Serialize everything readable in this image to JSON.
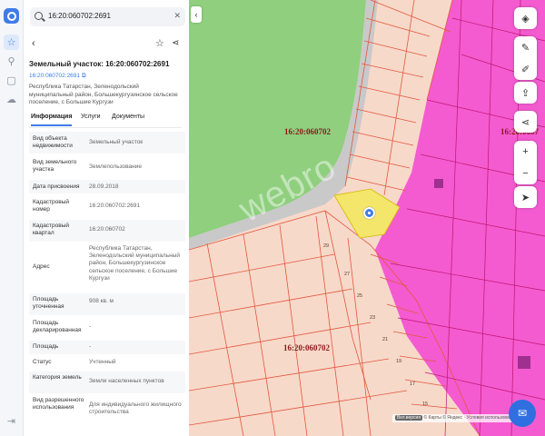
{
  "search": {
    "value": "16:20:060702:2691"
  },
  "panel": {
    "title": "Земельный участок: 16:20:060702:2691",
    "cad_link": "16:20:060702:2691",
    "address": "Республика Татарстан, Зеленодольский муниципальный район, Большекургузинское сельское поселение, с Большие Кургузи",
    "tabs": [
      "Информация",
      "Услуги",
      "Документы"
    ],
    "rows": [
      {
        "label": "Вид объекта недвижимости",
        "value": "Земельный участок"
      },
      {
        "label": "Вид земельного участка",
        "value": "Землепользование"
      },
      {
        "label": "Дата присвоения",
        "value": "28.09.2018"
      },
      {
        "label": "Кадастровый номер",
        "value": "16:20:060702:2691"
      },
      {
        "label": "Кадастровый квартал",
        "value": "16:20:060702"
      },
      {
        "label": "Адрес",
        "value": "Республика Татарстан, Зеленодольский муниципальный район, Большекургузинское сельское поселение, с Большие Кургузи"
      },
      {
        "label": "Площадь уточненная",
        "value": "908 кв. м"
      },
      {
        "label": "Площадь декларированная",
        "value": "-"
      },
      {
        "label": "Площадь",
        "value": "-"
      },
      {
        "label": "Статус",
        "value": "Учтенный"
      },
      {
        "label": "Категория земель",
        "value": "Земли населенных пунктов"
      },
      {
        "label": "Вид разрешенного использования",
        "value": "Для индивидуального жилищного строительства"
      }
    ]
  },
  "map": {
    "labels": [
      "16:20:060702",
      "16:20:060702",
      "16:20:0607"
    ],
    "plot_numbers": [
      "29",
      "27",
      "25",
      "23",
      "21",
      "19",
      "17",
      "15"
    ],
    "watermark": "webro",
    "attribution": {
      "toggle": "Вкл.версия",
      "text": "© Карты © Яндекс · Условия использования"
    },
    "colors": {
      "forest": "#8fcf7e",
      "parcels": "#f7d9ca",
      "zone": "#f45bd0",
      "selected": "#f3e66a",
      "lines": "#e2583e"
    }
  },
  "icons": {
    "rail": [
      "logo-icon",
      "star-icon",
      "pin-icon",
      "square-icon",
      "cloud-icon",
      "logout-icon"
    ],
    "map_buttons": [
      "layers-icon",
      "ruler-icon",
      "edit-icon",
      "upload-icon",
      "share-icon",
      "plus-icon",
      "minus-icon",
      "locate-icon"
    ]
  }
}
